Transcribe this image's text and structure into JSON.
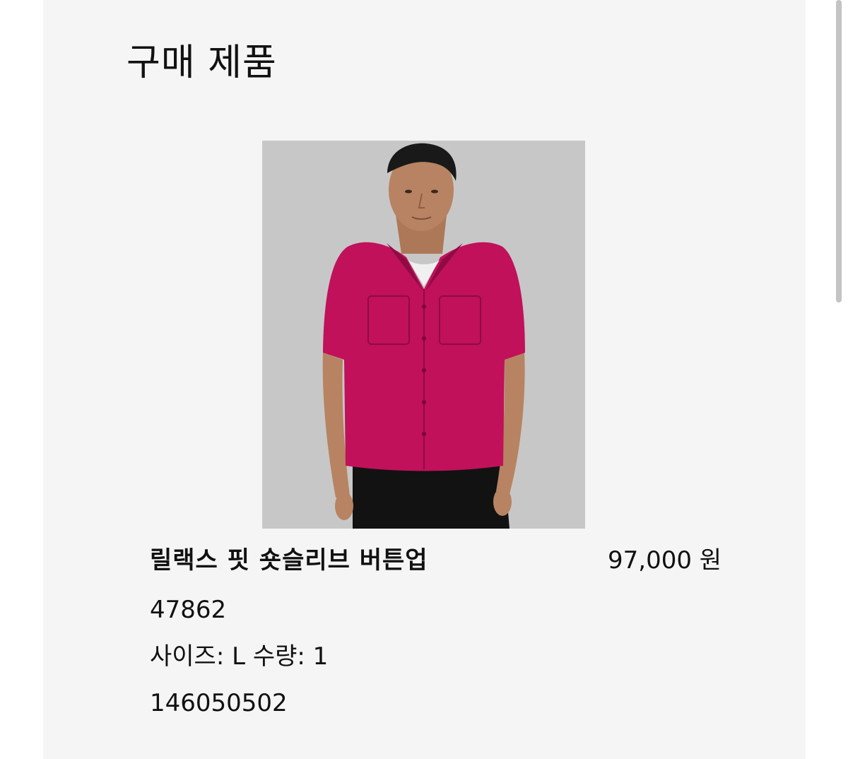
{
  "section": {
    "title": "구매 제품"
  },
  "product": {
    "image_alt": "product-photo-man-in-magenta-short-sleeve-button-up",
    "name": "릴랙스 핏 숏슬리브 버튼업",
    "price": "97,000 원",
    "style_number": "47862",
    "size_quantity": "사이즈: L 수량: 1",
    "order_number": "146050502",
    "shirt_color": "#c0115a",
    "background_color": "#c7c7c7"
  }
}
